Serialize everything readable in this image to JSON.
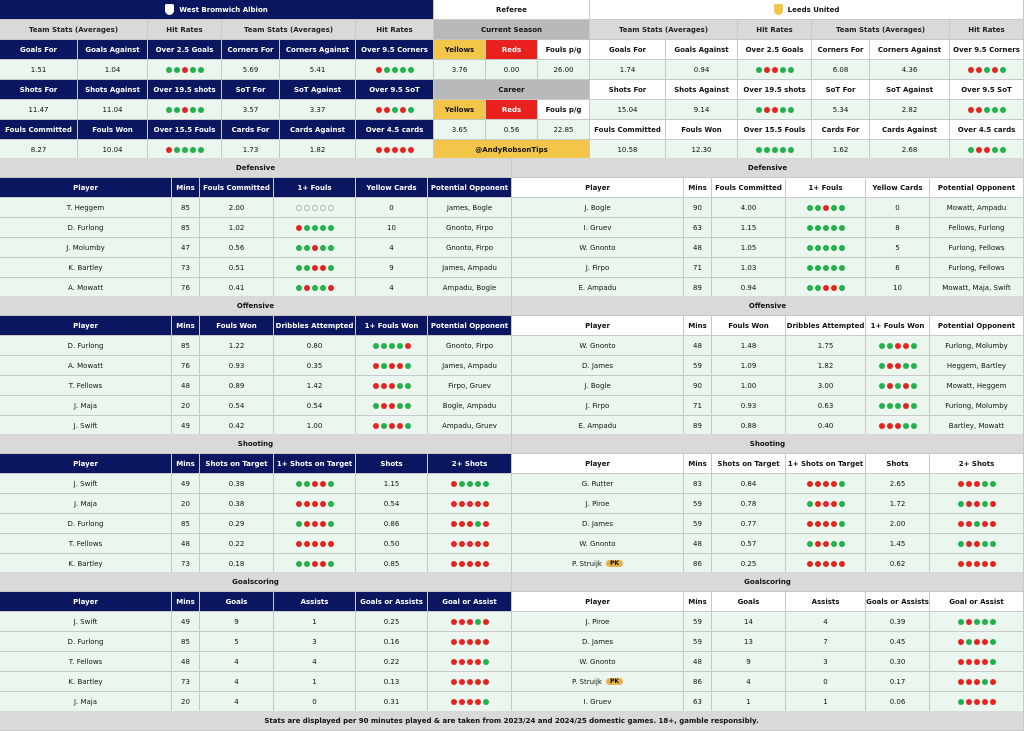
{
  "home": {
    "name": "West Bromwich Albion",
    "crest": "wba-crest-icon",
    "color": "#0b1660"
  },
  "away": {
    "name": "Leeds United",
    "crest": "leeds-crest-icon",
    "color": "#f3c64a"
  },
  "lbl": {
    "ts": "Team Stats (Averages)",
    "hr": "Hit Rates",
    "referee": "Referee",
    "cur": "Current Season",
    "career": "Career",
    "yellows": "Yellows",
    "reds": "Reds",
    "fpg": "Fouls p/g",
    "gf": "Goals For",
    "ga": "Goals Against",
    "o25": "Over 2.5 Goals",
    "cf": "Corners For",
    "ca": "Corners Against",
    "o95c": "Over 9.5 Corners",
    "sf": "Shots For",
    "sa": "Shots Against",
    "o195": "Over 19.5 shots",
    "sot": "SoT For",
    "sota": "SoT Against",
    "o95s": "Over 9.5 SoT",
    "fc": "Fouls Committed",
    "fw": "Fouls Won",
    "o155": "Over 15.5 Fouls",
    "cdf": "Cards For",
    "cda": "Cards Against",
    "o45": "Over 4.5 cards",
    "handle": "@AndyRobsonTips",
    "defensive": "Defensive",
    "offensive": "Offensive",
    "shooting": "Shooting",
    "goalscoring": "Goalscoring",
    "player": "Player",
    "mins": "Mins",
    "fouls1": "1+ Fouls",
    "yc": "Yellow Cards",
    "po": "Potential Opponent",
    "da": "Dribbles Attempted",
    "fw1": "1+ Fouls Won",
    "sot2": "Shots on Target",
    "sot1": "1+ Shots on Target",
    "shots": "Shots",
    "s2": "2+ Shots",
    "goals": "Goals",
    "assists": "Assists",
    "goa": "Goals or Assists",
    "goa2": "Goal or Assist",
    "pk": "PK",
    "footer": "Stats are displayed per 90 minutes played & are taken from 2023/24 and 2024/25 domestic games. 18+, gamble responsibly."
  },
  "ref": {
    "cur": {
      "y": "3.76",
      "r": "0.00",
      "f": "26.00"
    },
    "car": {
      "y": "3.65",
      "r": "0.56",
      "f": "22.85"
    }
  },
  "hstats": {
    "gf": "1.51",
    "ga": "1.04",
    "o25": "ggrgg",
    "cf": "5.69",
    "ca": "5.41",
    "o95c": "rgggg",
    "sf": "11.47",
    "sa": "11.04",
    "o195": "ggrgg",
    "sot": "3.57",
    "sota": "3.37",
    "o95s": "rrgrg",
    "fc": "8.27",
    "fw": "10.04",
    "o155": "rgggg",
    "cdf": "1.73",
    "cda": "1.82",
    "o45": "rrrrr"
  },
  "astats": {
    "gf": "1.74",
    "ga": "0.94",
    "o25": "grrgg",
    "cf": "6.08",
    "ca": "4.36",
    "o95c": "rrgrg",
    "sf": "15.04",
    "sa": "9.14",
    "o195": "grrgg",
    "sot": "5.34",
    "sota": "2.82",
    "o95s": "rrggg",
    "fc": "10.58",
    "fw": "12.30",
    "o155": "ggggg",
    "cdf": "1.62",
    "cda": "2.68",
    "o45": "grrgg"
  },
  "hdef": [
    [
      "T. Heggem",
      "85",
      "2.00",
      "eeeee",
      "0",
      "James, Bogle"
    ],
    [
      "D. Furlong",
      "85",
      "1.02",
      "rgggg",
      "10",
      "Gnonto, Firpo"
    ],
    [
      "J. Molumby",
      "47",
      "0.56",
      "ggrgg",
      "4",
      "Gnonto, Firpo"
    ],
    [
      "K. Bartley",
      "73",
      "0.51",
      "ggrrg",
      "9",
      "James, Ampadu"
    ],
    [
      "A. Mowatt",
      "76",
      "0.41",
      "grggr",
      "4",
      "Ampadu, Bogle"
    ]
  ],
  "adef": [
    [
      "J. Bogle",
      "90",
      "4.00",
      "ggrgg",
      "0",
      "Mowatt, Ampadu"
    ],
    [
      "I. Gruev",
      "63",
      "1.15",
      "ggggg",
      "8",
      "Fellows, Furlong"
    ],
    [
      "W. Gnonto",
      "48",
      "1.05",
      "ggggg",
      "5",
      "Furlong, Fellows"
    ],
    [
      "J. Firpo",
      "71",
      "1.03",
      "ggggg",
      "6",
      "Furlong, Fellows"
    ],
    [
      "E. Ampadu",
      "89",
      "0.94",
      "ggrrg",
      "10",
      "Mowatt, Maja, Swift"
    ]
  ],
  "hoff": [
    [
      "D. Furlong",
      "85",
      "1.22",
      "0.80",
      "ggggr",
      "Gnonto, Firpo"
    ],
    [
      "A. Mowatt",
      "76",
      "0.93",
      "0.35",
      "rgrrg",
      "James, Ampadu"
    ],
    [
      "T. Fellows",
      "48",
      "0.89",
      "1.42",
      "rrrgg",
      "Firpo, Gruev"
    ],
    [
      "J. Maja",
      "20",
      "0.54",
      "0.54",
      "grrgg",
      "Bogle, Ampadu"
    ],
    [
      "J. Swift",
      "49",
      "0.42",
      "1.00",
      "rgrrg",
      "Ampadu, Gruev"
    ]
  ],
  "aoff": [
    [
      "W. Gnonto",
      "48",
      "1.48",
      "1.75",
      "ggrrg",
      "Furlong, Molumby"
    ],
    [
      "D. James",
      "59",
      "1.09",
      "1.82",
      "grrgg",
      "Heggem, Bartley"
    ],
    [
      "J. Bogle",
      "90",
      "1.00",
      "3.00",
      "grgrg",
      "Mowatt, Heggem"
    ],
    [
      "J. Firpo",
      "71",
      "0.93",
      "0.63",
      "gggrg",
      "Furlong, Molumby"
    ],
    [
      "E. Ampadu",
      "89",
      "0.88",
      "0.40",
      "rrrgg",
      "Bartley, Mowatt"
    ]
  ],
  "hsht": [
    [
      "J. Swift",
      "49",
      "0.38",
      "ggrrg",
      "1.15",
      "rgggg"
    ],
    [
      "J. Maja",
      "20",
      "0.38",
      "rrrrg",
      "0.54",
      "rrrrr"
    ],
    [
      "D. Furlong",
      "85",
      "0.29",
      "grrrg",
      "0.86",
      "rrrgr"
    ],
    [
      "T. Fellows",
      "48",
      "0.22",
      "rrrrr",
      "0.50",
      "rrrrr"
    ],
    [
      "K. Bartley",
      "73",
      "0.18",
      "ggrrg",
      "0.85",
      "rrrrr"
    ]
  ],
  "asht": [
    [
      "G. Rutter",
      "83",
      "0.84",
      "rrrrg",
      "2.65",
      "rrrgg"
    ],
    [
      "J. Piroe",
      "59",
      "0.78",
      "grrrg",
      "1.72",
      "grrgr"
    ],
    [
      "D. James",
      "59",
      "0.77",
      "rrrrg",
      "2.00",
      "rrgrr"
    ],
    [
      "W. Gnonto",
      "48",
      "0.57",
      "grrgg",
      "1.45",
      "grrgg"
    ],
    [
      "P. Struijk",
      "86",
      "0.25",
      "rrrrr",
      "0.62",
      "rrrrr"
    ]
  ],
  "hgs": [
    [
      "J. Swift",
      "49",
      "9",
      "1",
      "0.25",
      "rrrgr"
    ],
    [
      "D. Furlong",
      "85",
      "5",
      "3",
      "0.16",
      "rrrrr"
    ],
    [
      "T. Fellows",
      "48",
      "4",
      "4",
      "0.22",
      "rrrrg"
    ],
    [
      "K. Bartley",
      "73",
      "4",
      "1",
      "0.13",
      "rrrrr"
    ],
    [
      "J. Maja",
      "20",
      "4",
      "0",
      "0.31",
      "rrrrg"
    ]
  ],
  "ags": [
    [
      "J. Piroe",
      "59",
      "14",
      "4",
      "0.39",
      "grggg"
    ],
    [
      "D. James",
      "59",
      "13",
      "7",
      "0.45",
      "rgrrg"
    ],
    [
      "W. Gnonto",
      "48",
      "9",
      "3",
      "0.30",
      "rrrrg"
    ],
    [
      "P. Struijk",
      "86",
      "4",
      "0",
      "0.17",
      "rrrgr"
    ],
    [
      "I. Gruev",
      "63",
      "1",
      "1",
      "0.06",
      "grrrr"
    ]
  ]
}
